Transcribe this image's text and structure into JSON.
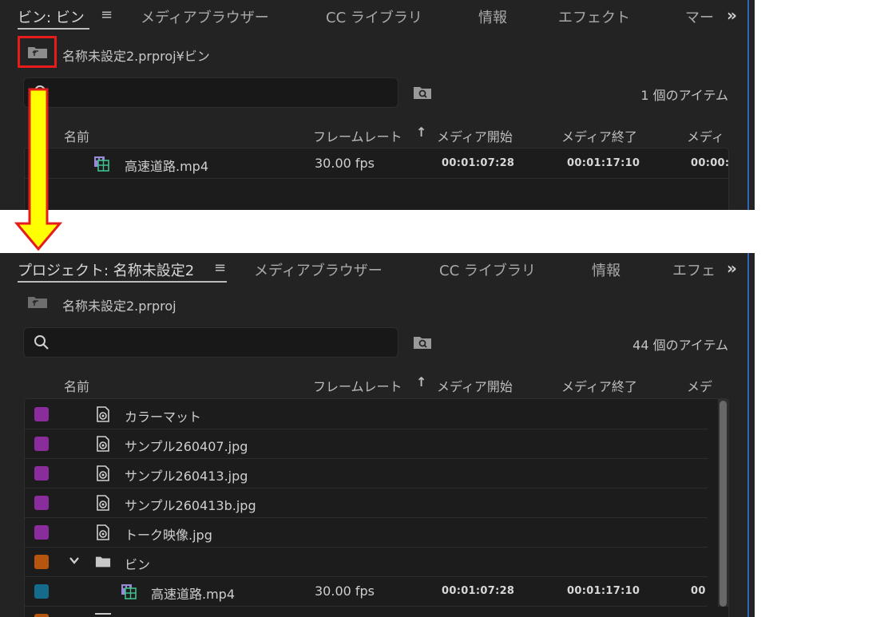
{
  "top_panel": {
    "tabs": [
      {
        "label": "ビン: ビン",
        "active": true
      },
      {
        "label": "メディアブラウザー"
      },
      {
        "label": "CC ライブラリ"
      },
      {
        "label": "情報"
      },
      {
        "label": "エフェクト"
      },
      {
        "label": "マー"
      }
    ],
    "menu_glyph": "≡",
    "overflow_glyph": "»",
    "path": "名称未設定2.prproj¥ビン",
    "item_count": "1 個のアイテム",
    "columns": {
      "name": "名前",
      "frame_rate": "フレームレート",
      "sort_arrow": "↑",
      "media_start": "メディア開始",
      "media_end": "メディア終了",
      "media_more": "メディ"
    },
    "rows": [
      {
        "name": "高速道路.mp4",
        "fps": "30.00 fps",
        "start": "00:01:07:28",
        "end": "00:01:17:10",
        "more": "00:00:"
      }
    ]
  },
  "bottom_panel": {
    "tabs": [
      {
        "label": "プロジェクト: 名称未設定2",
        "active": true
      },
      {
        "label": "メディアブラウザー"
      },
      {
        "label": "CC ライブラリ"
      },
      {
        "label": "情報"
      },
      {
        "label": "エフェ"
      }
    ],
    "menu_glyph": "≡",
    "overflow_glyph": "»",
    "path": "名称未設定2.prproj",
    "item_count": "44 個のアイテム",
    "columns": {
      "name": "名前",
      "frame_rate": "フレームレート",
      "sort_arrow": "↑",
      "media_start": "メディア開始",
      "media_end": "メディア終了",
      "media_more": "メデ"
    },
    "rows": [
      {
        "name": "カラーマット",
        "color": "#8b2c9c",
        "icon": "still-image-icon"
      },
      {
        "name": "サンプル260407.jpg",
        "color": "#8b2c9c",
        "icon": "still-image-icon"
      },
      {
        "name": "サンプル260413.jpg",
        "color": "#8b2c9c",
        "icon": "still-image-icon"
      },
      {
        "name": "サンプル260413b.jpg",
        "color": "#8b2c9c",
        "icon": "still-image-icon"
      },
      {
        "name": "トーク映像.jpg",
        "color": "#8b2c9c",
        "icon": "still-image-icon"
      },
      {
        "name": "ビン",
        "color": "#b5550f",
        "icon": "folder-icon",
        "expanded": true
      },
      {
        "name": "高速道路.mp4",
        "color": "#146b8c",
        "icon": "video-clip-icon",
        "fps": "30.00 fps",
        "start": "00:01:07:28",
        "end": "00:01:17:10",
        "more": "00"
      }
    ]
  },
  "annotation": {
    "highlight_color": "#e61c1c",
    "arrow_fill": "#ffff00",
    "arrow_stroke": "#e61c1c"
  }
}
